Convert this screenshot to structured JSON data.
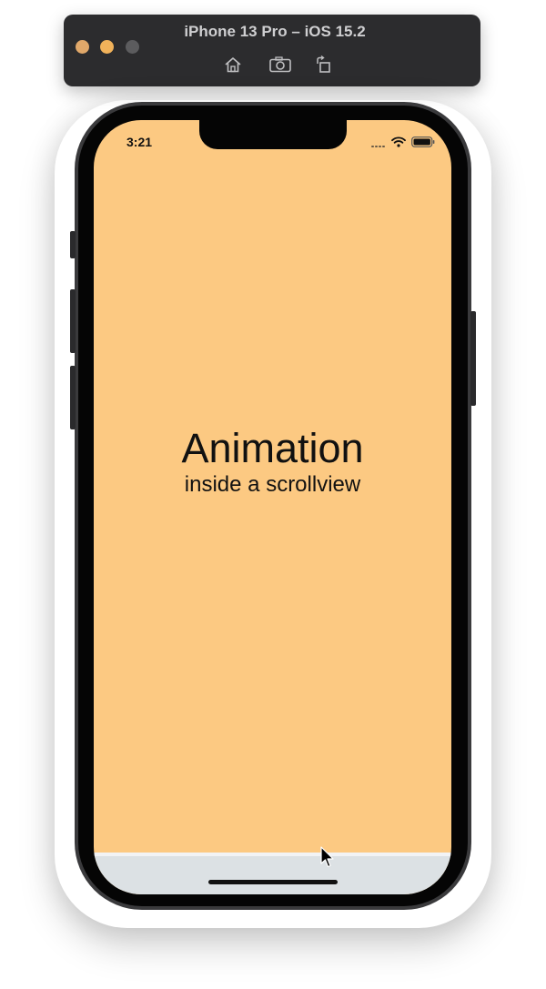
{
  "simulator": {
    "title": "iPhone 13 Pro – iOS 15.2",
    "toolbar": {
      "home_icon": "home-icon",
      "screenshot_icon": "camera-icon",
      "rotate_icon": "rotate-icon"
    }
  },
  "status_bar": {
    "time": "3:21"
  },
  "main": {
    "title": "Animation",
    "subtitle": "inside a scrollview"
  },
  "colors": {
    "background": "#fcc982",
    "bottom_strip": "#dce1e4",
    "text": "#111111"
  }
}
